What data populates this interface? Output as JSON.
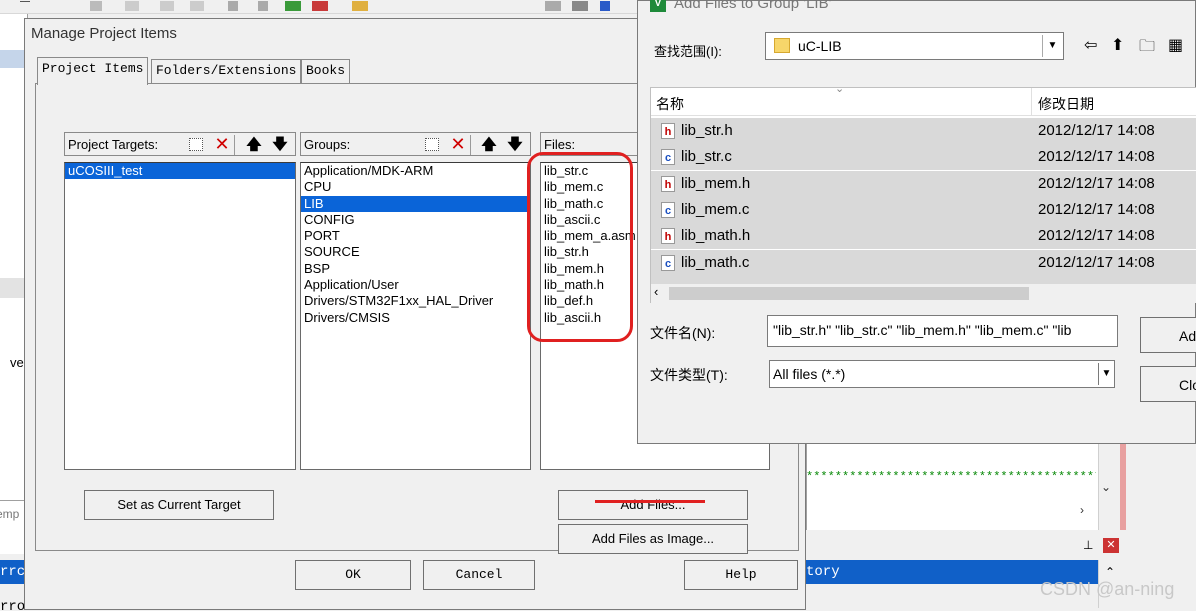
{
  "manage_dialog": {
    "title": "Manage Project Items",
    "tabs": [
      "Project Items",
      "Folders/Extensions",
      "Books"
    ],
    "targets": {
      "label": "Project Targets:",
      "items": [
        "uCOSIII_test"
      ],
      "selected": "uCOSIII_test"
    },
    "groups": {
      "label": "Groups:",
      "items": [
        "Application/MDK-ARM",
        "CPU",
        "LIB",
        "CONFIG",
        "PORT",
        "SOURCE",
        "BSP",
        "Application/User",
        "Drivers/STM32F1xx_HAL_Driver",
        "Drivers/CMSIS"
      ],
      "selected": "LIB"
    },
    "files": {
      "label": "Files:",
      "items": [
        "lib_str.c",
        "lib_mem.c",
        "lib_math.c",
        "lib_ascii.c",
        "lib_mem_a.asm",
        "lib_str.h",
        "lib_mem.h",
        "lib_math.h",
        "lib_def.h",
        "lib_ascii.h"
      ]
    },
    "buttons": {
      "set_target": "Set as Current Target",
      "add_files": "Add Files...",
      "add_files_image": "Add Files as Image...",
      "ok": "OK",
      "cancel": "Cancel",
      "help": "Help"
    },
    "icons": [
      "new-icon",
      "delete-icon",
      "move-up-icon",
      "move-down-icon"
    ],
    "accent_color": "#0a64d8",
    "annotation_color": "#e02020"
  },
  "add_files_dialog": {
    "title": "Add Files to Group 'LIB'",
    "look_in_label": "查找范围(I):",
    "look_in_value": "uC-LIB",
    "columns": {
      "name": "名称",
      "date": "修改日期"
    },
    "files": [
      {
        "icon": "h",
        "name": "lib_str.h",
        "date": "2012/12/17 14:08"
      },
      {
        "icon": "c",
        "name": "lib_str.c",
        "date": "2012/12/17 14:08"
      },
      {
        "icon": "h",
        "name": "lib_mem.h",
        "date": "2012/12/17 14:08"
      },
      {
        "icon": "c",
        "name": "lib_mem.c",
        "date": "2012/12/17 14:08"
      },
      {
        "icon": "h",
        "name": "lib_math.h",
        "date": "2012/12/17 14:08"
      },
      {
        "icon": "c",
        "name": "lib_math.c",
        "date": "2012/12/17 14:08"
      }
    ],
    "filename_label": "文件名(N):",
    "filename_value": "\"lib_str.h\" \"lib_str.c\" \"lib_mem.h\" \"lib_mem.c\" \"lib",
    "filetype_label": "文件类型(T):",
    "filetype_value": "All files (*.*)",
    "add_button": "Ad",
    "close_button": "Clo"
  },
  "background": {
    "left_fragment": "ver",
    "left_bottom_fragment": "emp",
    "output_left": "rrc",
    "output_right": "tory",
    "bottom_fragment": "rror",
    "stars": "*****************************************:",
    "watermark": "CSDN @an-ning"
  }
}
